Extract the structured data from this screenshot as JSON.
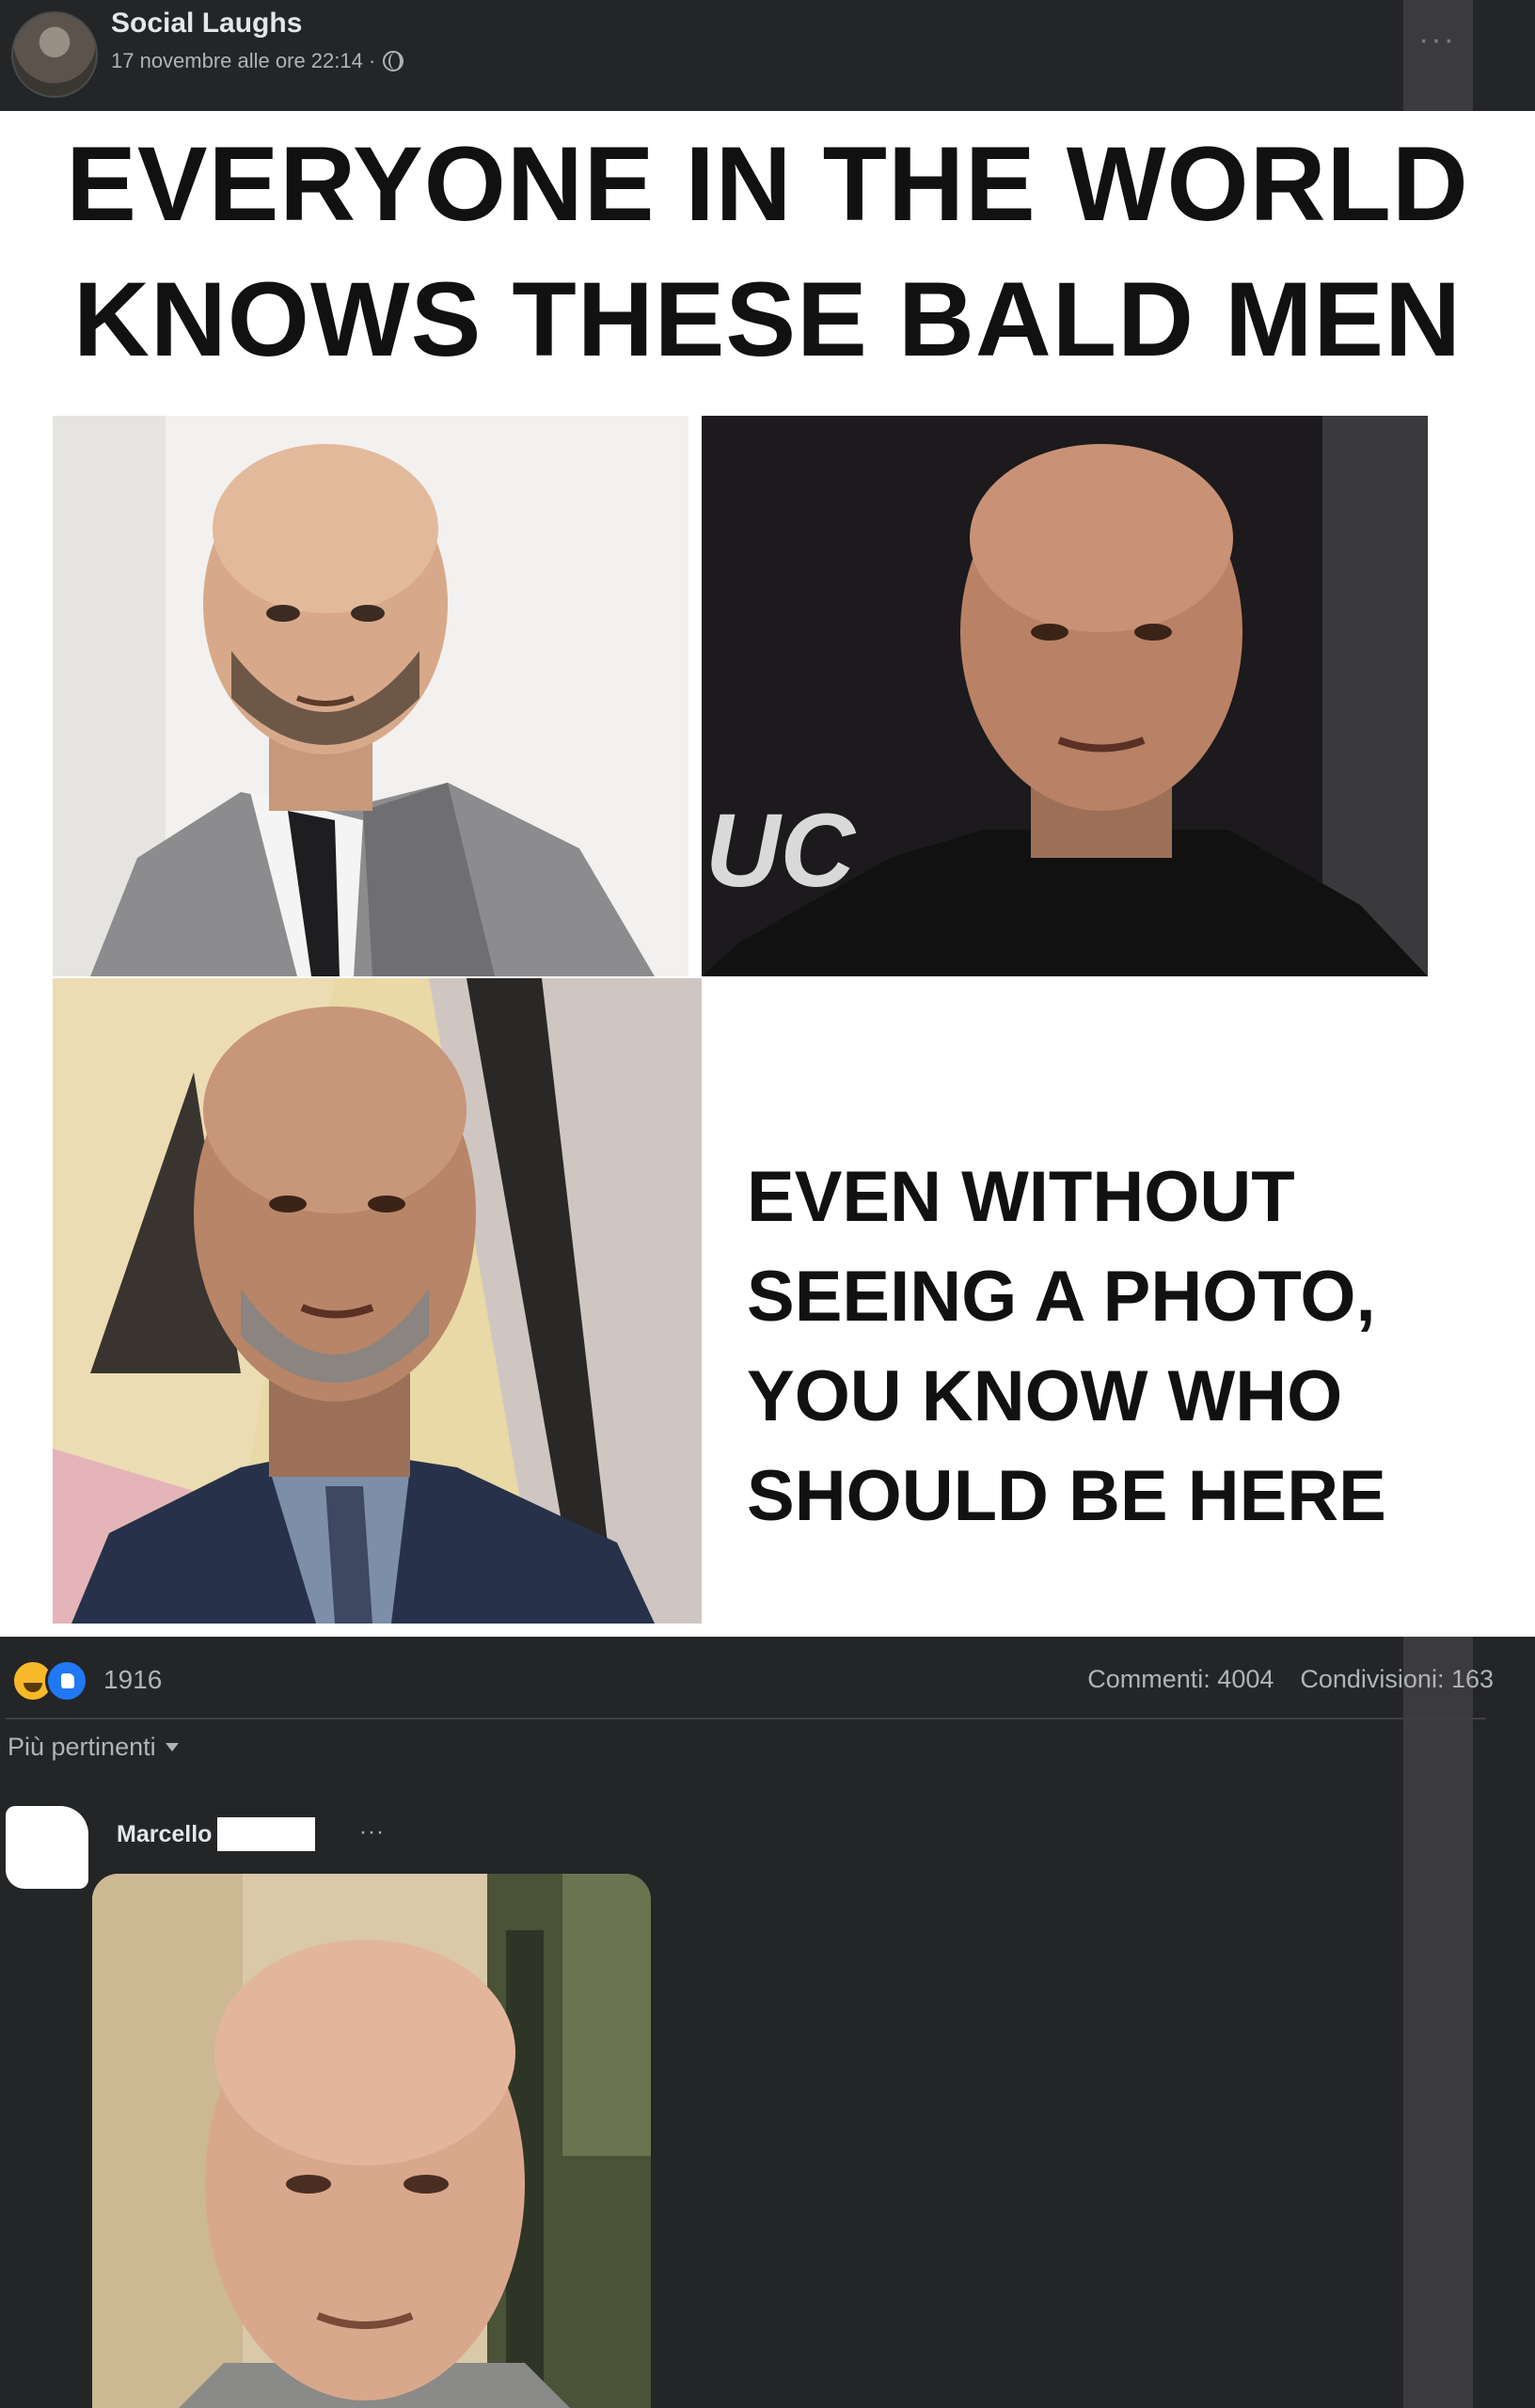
{
  "post": {
    "page_name": "Social Laughs",
    "timestamp": "17 novembre alle ore 22:14 ·",
    "more_icon": "more-horizontal-icon",
    "privacy_icon": "globe-icon"
  },
  "meme": {
    "title_lines": [
      "EVERYONE IN THE WORLD",
      "KNOWS THESE BALD MEN"
    ],
    "caption_lines": [
      "EVEN WITHOUT",
      "SEEING A PHOTO,",
      "YOU KNOW WHO",
      "SHOULD BE HERE"
    ],
    "photo_2_backdrop_text": "UC"
  },
  "stats": {
    "reaction_count": "1916",
    "comments": "Commenti: 4004",
    "shares": "Condivisioni: 163"
  },
  "comments_section": {
    "sort_label": "Più pertinenti"
  },
  "comment": {
    "author": "Marcello",
    "more": "···"
  },
  "colors": {
    "background": "#242526",
    "text_primary": "#e4e6eb",
    "text_secondary": "#b0b3b8",
    "like_blue": "#2078f4",
    "haha_yellow": "#f7b928"
  }
}
